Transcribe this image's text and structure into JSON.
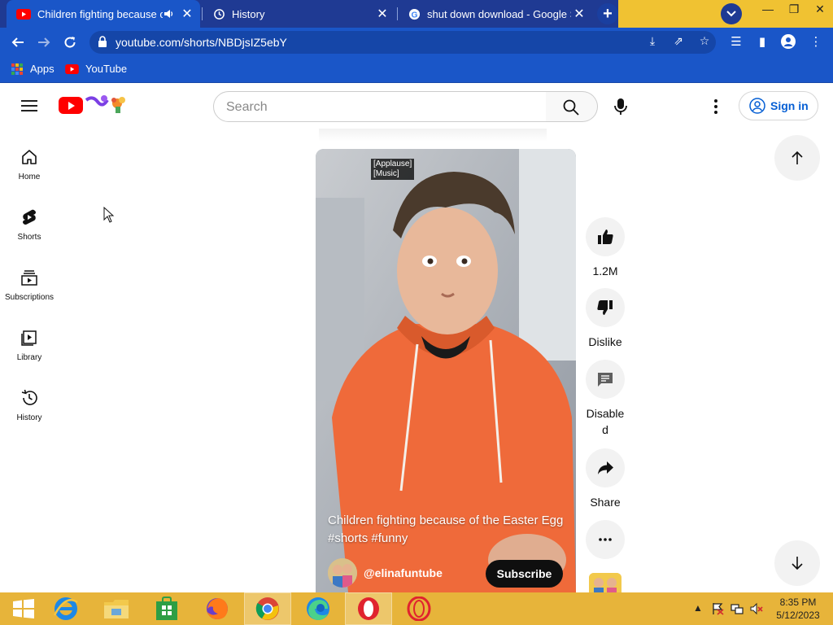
{
  "browser": {
    "tabs": [
      {
        "title": "Children fighting because of",
        "icon": "youtube-favicon",
        "active": true,
        "muted_icon": "speaker-icon"
      },
      {
        "title": "History",
        "icon": "history-icon",
        "active": false
      },
      {
        "title": "shut down download - Google Se",
        "icon": "google-favicon",
        "active": false
      }
    ],
    "url": "youtube.com/shorts/NBDjsIZ5ebY",
    "bookmarks": [
      {
        "label": "Apps",
        "icon": "apps-grid-icon"
      },
      {
        "label": "YouTube",
        "icon": "youtube-favicon"
      }
    ],
    "colors": {
      "tabstrip": "#1f3a93",
      "toolbar": "#1a56c8",
      "accent": "#f0c232"
    }
  },
  "youtube": {
    "search_placeholder": "Search",
    "signin_label": "Sign in",
    "guide": [
      {
        "label": "Home",
        "icon": "home-icon"
      },
      {
        "label": "Shorts",
        "icon": "shorts-icon"
      },
      {
        "label": "Subscriptions",
        "icon": "subscriptions-icon"
      },
      {
        "label": "Library",
        "icon": "library-icon"
      },
      {
        "label": "History",
        "icon": "history-icon"
      }
    ],
    "short": {
      "captions": [
        "[Applause]",
        "[Music]"
      ],
      "title": "Children fighting because of the Easter Egg #shorts #funny",
      "channel": "@elinafuntube",
      "subscribe_label": "Subscribe"
    },
    "actions": [
      {
        "label": "1.2M",
        "icon": "thumbs-up-icon"
      },
      {
        "label": "Dislike",
        "icon": "thumbs-down-icon"
      },
      {
        "label": "Disabled",
        "icon": "comments-icon"
      },
      {
        "label": "Share",
        "icon": "share-icon"
      },
      {
        "label": "",
        "icon": "more-horizontal-icon"
      }
    ]
  },
  "taskbar": {
    "time": "8:35 PM",
    "date": "5/12/2023",
    "apps": [
      "windows-start-icon",
      "internet-explorer-icon",
      "file-explorer-icon",
      "store-icon",
      "firefox-icon",
      "chrome-icon",
      "edge-icon",
      "opera-icon",
      "opera-gx-icon"
    ]
  }
}
